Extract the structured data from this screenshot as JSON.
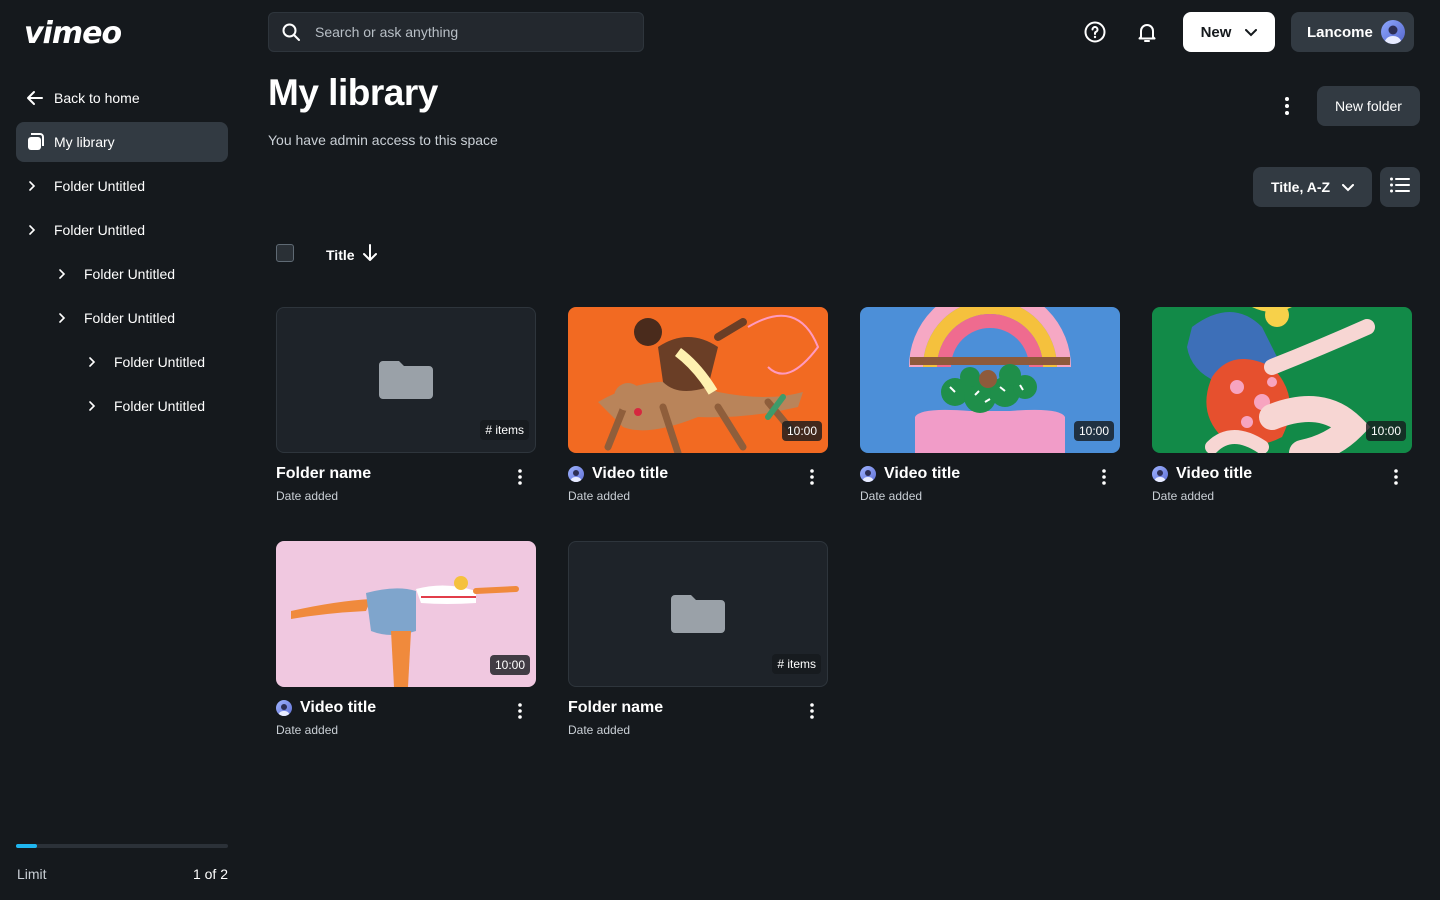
{
  "brand": {
    "logo": "vimeo"
  },
  "sidebar": {
    "back_label": "Back to home",
    "my_library_label": "My library",
    "tree": [
      {
        "label": "Folder Untitled",
        "level": 0
      },
      {
        "label": "Folder Untitled",
        "level": 0
      },
      {
        "label": "Folder Untitled",
        "level": 1
      },
      {
        "label": "Folder Untitled",
        "level": 1
      },
      {
        "label": "Folder Untitled",
        "level": 2
      },
      {
        "label": "Folder Untitled",
        "level": 2
      }
    ],
    "limit": {
      "label": "Limit",
      "value": "1 of 2",
      "progress": 0.1
    }
  },
  "header": {
    "search_placeholder": "Search or ask anything",
    "new_label": "New",
    "user_label": "Lancome"
  },
  "page": {
    "title": "My library",
    "subtitle": "You have admin access to this space",
    "new_folder_label": "New folder",
    "sort_label": "Title, A-Z",
    "column_title": "Title"
  },
  "items": [
    {
      "type": "folder",
      "name": "Folder name",
      "date": "Date added",
      "badge": "# items"
    },
    {
      "type": "video",
      "name": "Video title",
      "date": "Date added",
      "badge": "10:00",
      "art": "orange"
    },
    {
      "type": "video",
      "name": "Video title",
      "date": "Date added",
      "badge": "10:00",
      "art": "blue"
    },
    {
      "type": "video",
      "name": "Video title",
      "date": "Date added",
      "badge": "10:00",
      "art": "green"
    },
    {
      "type": "video",
      "name": "Video title",
      "date": "Date added",
      "badge": "10:00",
      "art": "pink"
    },
    {
      "type": "folder",
      "name": "Folder name",
      "date": "Date added",
      "badge": "# items"
    }
  ],
  "colors": {
    "background": "#15191d",
    "surface": "#323a42",
    "accent": "#1fb6f0"
  }
}
